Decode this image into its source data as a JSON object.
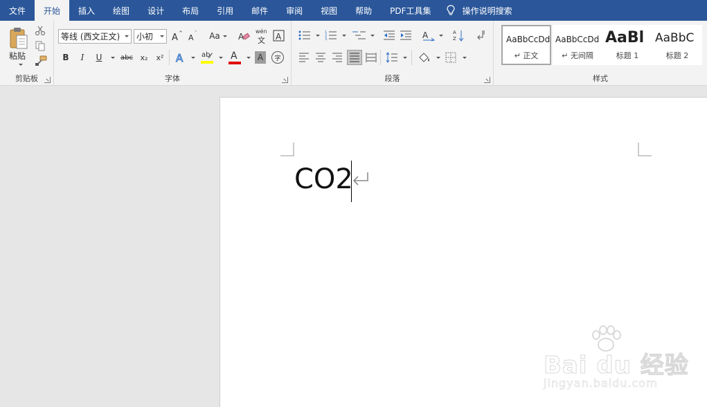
{
  "tabs": [
    {
      "label": "文件",
      "active": false
    },
    {
      "label": "开始",
      "active": true
    },
    {
      "label": "插入",
      "active": false
    },
    {
      "label": "绘图",
      "active": false
    },
    {
      "label": "设计",
      "active": false
    },
    {
      "label": "布局",
      "active": false
    },
    {
      "label": "引用",
      "active": false
    },
    {
      "label": "邮件",
      "active": false
    },
    {
      "label": "审阅",
      "active": false
    },
    {
      "label": "视图",
      "active": false
    },
    {
      "label": "帮助",
      "active": false
    },
    {
      "label": "PDF工具集",
      "active": false
    }
  ],
  "tell_me": "操作说明搜索",
  "clipboard": {
    "paste_label": "粘贴",
    "group_label": "剪贴板"
  },
  "font": {
    "font_name": "等线 (西文正文)",
    "font_size": "小初",
    "group_label": "字体",
    "wen_top": "wén",
    "wen_bottom": "文",
    "aa_label": "Aa",
    "bold": "B",
    "italic": "I",
    "underline": "U",
    "strike": "abc",
    "subscript": "x₂",
    "superscript": "x²",
    "highlight_label": "ab",
    "font_color_label": "A",
    "char_shading_label": "A",
    "enclose_label": "字"
  },
  "paragraph": {
    "group_label": "段落"
  },
  "styles": {
    "group_label": "样式",
    "items": [
      {
        "sample": "AaBbCcDd",
        "name": "↵ 正文"
      },
      {
        "sample": "AaBbCcDd",
        "name": "↵ 无间隔"
      },
      {
        "sample": "AaBl",
        "name": "标题 1"
      },
      {
        "sample": "AaBbC",
        "name": "标题 2"
      }
    ]
  },
  "document": {
    "text": "CO2"
  },
  "watermark": {
    "brand": "Bai du 经验",
    "url": "jingyan.baidu.com"
  },
  "colors": {
    "accent": "#2b579a",
    "highlight": "#ffff00",
    "font_color": "#e00000"
  }
}
